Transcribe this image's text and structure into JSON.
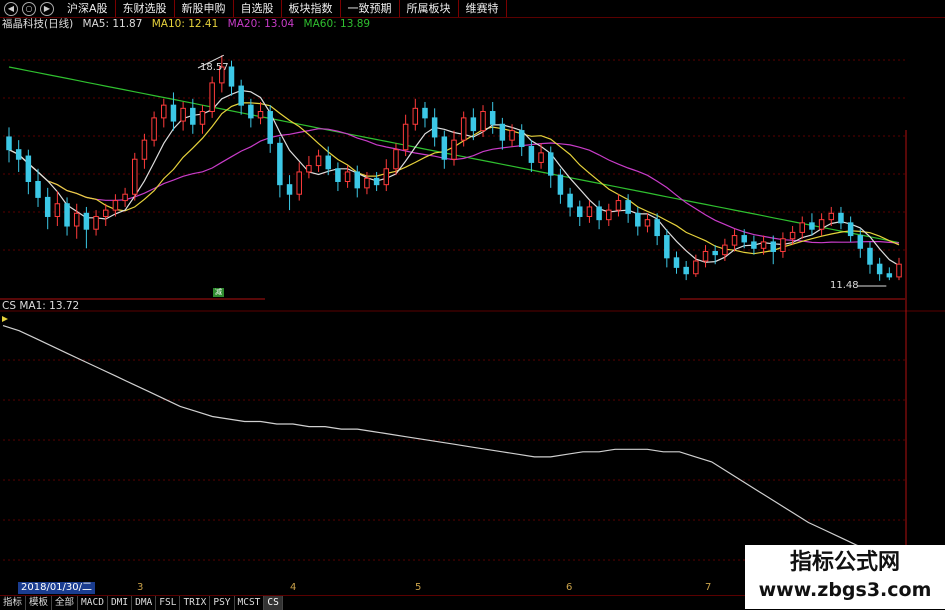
{
  "toolbar": {
    "icons": [
      "back-icon",
      "refresh-icon",
      "forward-icon"
    ],
    "tabs": [
      "沪深A股",
      "东财选股",
      "新股申购",
      "自选股",
      "板块指数",
      "一致预期",
      "所属板块",
      "维赛特"
    ]
  },
  "header": {
    "stock": "福晶科技(日线)",
    "ma5": "MA5: 11.87",
    "ma10": "MA10: 12.41",
    "ma20": "MA20: 13.04",
    "ma60": "MA60: 13.89"
  },
  "colors": {
    "up": "#ff3b3b",
    "down": "#3cc8e6",
    "ma5": "#dddddd",
    "ma10": "#e6d23c",
    "ma20": "#c83cc8",
    "ma60": "#2fbf2f",
    "grid": "#5a0000",
    "sub": "#d0d0d0"
  },
  "main_chart": {
    "high_label": "18.57",
    "low_label": "11.48",
    "marker_label": "减"
  },
  "sub_chart": {
    "label": "CS MA1: 13.72"
  },
  "chart_data": {
    "type": "candlestick",
    "title": "福晶科技(日线)",
    "candles": [
      {
        "o": 16.0,
        "c": 15.6,
        "h": 16.3,
        "l": 15.2
      },
      {
        "o": 15.6,
        "c": 15.3,
        "h": 15.9,
        "l": 14.9
      },
      {
        "o": 15.4,
        "c": 14.6,
        "h": 15.6,
        "l": 14.2
      },
      {
        "o": 14.6,
        "c": 14.1,
        "h": 15.0,
        "l": 13.8
      },
      {
        "o": 14.1,
        "c": 13.5,
        "h": 14.4,
        "l": 13.1
      },
      {
        "o": 13.5,
        "c": 13.9,
        "h": 14.3,
        "l": 13.2
      },
      {
        "o": 13.9,
        "c": 13.2,
        "h": 14.1,
        "l": 12.9
      },
      {
        "o": 13.2,
        "c": 13.6,
        "h": 13.9,
        "l": 12.8
      },
      {
        "o": 13.6,
        "c": 13.1,
        "h": 13.8,
        "l": 12.5
      },
      {
        "o": 13.1,
        "c": 13.5,
        "h": 13.7,
        "l": 12.9
      },
      {
        "o": 13.5,
        "c": 13.7,
        "h": 13.9,
        "l": 13.2
      },
      {
        "o": 13.7,
        "c": 14.0,
        "h": 14.2,
        "l": 13.5
      },
      {
        "o": 14.0,
        "c": 14.2,
        "h": 14.4,
        "l": 13.8
      },
      {
        "o": 14.2,
        "c": 15.3,
        "h": 15.5,
        "l": 14.0
      },
      {
        "o": 15.3,
        "c": 15.9,
        "h": 16.1,
        "l": 15.0
      },
      {
        "o": 15.9,
        "c": 16.6,
        "h": 16.8,
        "l": 15.7
      },
      {
        "o": 16.6,
        "c": 17.0,
        "h": 17.2,
        "l": 16.3
      },
      {
        "o": 17.0,
        "c": 16.5,
        "h": 17.4,
        "l": 16.2
      },
      {
        "o": 16.5,
        "c": 16.9,
        "h": 17.1,
        "l": 16.2
      },
      {
        "o": 16.9,
        "c": 16.4,
        "h": 17.2,
        "l": 16.1
      },
      {
        "o": 16.4,
        "c": 16.8,
        "h": 17.0,
        "l": 16.1
      },
      {
        "o": 16.8,
        "c": 17.7,
        "h": 17.9,
        "l": 16.6
      },
      {
        "o": 17.7,
        "c": 18.2,
        "h": 18.57,
        "l": 17.4
      },
      {
        "o": 18.2,
        "c": 17.6,
        "h": 18.4,
        "l": 17.3
      },
      {
        "o": 17.6,
        "c": 17.0,
        "h": 17.8,
        "l": 16.7
      },
      {
        "o": 17.0,
        "c": 16.6,
        "h": 17.2,
        "l": 16.3
      },
      {
        "o": 16.6,
        "c": 16.8,
        "h": 17.1,
        "l": 16.4
      },
      {
        "o": 16.8,
        "c": 15.8,
        "h": 17.0,
        "l": 15.5
      },
      {
        "o": 15.8,
        "c": 14.5,
        "h": 16.0,
        "l": 14.1
      },
      {
        "o": 14.5,
        "c": 14.2,
        "h": 14.8,
        "l": 13.7
      },
      {
        "o": 14.2,
        "c": 14.9,
        "h": 15.2,
        "l": 14.0
      },
      {
        "o": 14.9,
        "c": 15.1,
        "h": 15.4,
        "l": 14.7
      },
      {
        "o": 15.1,
        "c": 15.4,
        "h": 15.6,
        "l": 14.9
      },
      {
        "o": 15.4,
        "c": 15.0,
        "h": 15.7,
        "l": 14.8
      },
      {
        "o": 15.0,
        "c": 14.6,
        "h": 15.2,
        "l": 14.3
      },
      {
        "o": 14.6,
        "c": 14.9,
        "h": 15.1,
        "l": 14.4
      },
      {
        "o": 14.9,
        "c": 14.4,
        "h": 15.1,
        "l": 14.1
      },
      {
        "o": 14.4,
        "c": 14.7,
        "h": 14.9,
        "l": 14.2
      },
      {
        "o": 14.7,
        "c": 14.5,
        "h": 14.9,
        "l": 14.3
      },
      {
        "o": 14.5,
        "c": 15.0,
        "h": 15.3,
        "l": 14.3
      },
      {
        "o": 15.0,
        "c": 15.6,
        "h": 15.8,
        "l": 14.8
      },
      {
        "o": 15.6,
        "c": 16.4,
        "h": 16.7,
        "l": 15.4
      },
      {
        "o": 16.4,
        "c": 16.9,
        "h": 17.2,
        "l": 16.2
      },
      {
        "o": 16.9,
        "c": 16.6,
        "h": 17.1,
        "l": 16.3
      },
      {
        "o": 16.6,
        "c": 16.0,
        "h": 16.9,
        "l": 15.7
      },
      {
        "o": 16.0,
        "c": 15.3,
        "h": 16.2,
        "l": 15.0
      },
      {
        "o": 15.3,
        "c": 15.9,
        "h": 16.2,
        "l": 15.1
      },
      {
        "o": 15.9,
        "c": 16.6,
        "h": 16.8,
        "l": 15.7
      },
      {
        "o": 16.6,
        "c": 16.2,
        "h": 16.9,
        "l": 15.9
      },
      {
        "o": 16.2,
        "c": 16.8,
        "h": 17.0,
        "l": 16.0
      },
      {
        "o": 16.8,
        "c": 16.4,
        "h": 17.1,
        "l": 16.1
      },
      {
        "o": 16.4,
        "c": 15.9,
        "h": 16.6,
        "l": 15.6
      },
      {
        "o": 15.9,
        "c": 16.2,
        "h": 16.4,
        "l": 15.7
      },
      {
        "o": 16.2,
        "c": 15.7,
        "h": 16.4,
        "l": 15.4
      },
      {
        "o": 15.7,
        "c": 15.2,
        "h": 15.9,
        "l": 14.9
      },
      {
        "o": 15.2,
        "c": 15.5,
        "h": 15.8,
        "l": 15.0
      },
      {
        "o": 15.5,
        "c": 14.8,
        "h": 15.7,
        "l": 14.4
      },
      {
        "o": 14.8,
        "c": 14.2,
        "h": 15.0,
        "l": 13.9
      },
      {
        "o": 14.2,
        "c": 13.8,
        "h": 14.4,
        "l": 13.5
      },
      {
        "o": 13.8,
        "c": 13.5,
        "h": 14.0,
        "l": 13.2
      },
      {
        "o": 13.5,
        "c": 13.8,
        "h": 14.0,
        "l": 13.3
      },
      {
        "o": 13.8,
        "c": 13.4,
        "h": 14.0,
        "l": 13.1
      },
      {
        "o": 13.4,
        "c": 13.7,
        "h": 13.9,
        "l": 13.2
      },
      {
        "o": 13.7,
        "c": 14.0,
        "h": 14.2,
        "l": 13.5
      },
      {
        "o": 14.0,
        "c": 13.6,
        "h": 14.2,
        "l": 13.3
      },
      {
        "o": 13.6,
        "c": 13.2,
        "h": 13.8,
        "l": 12.9
      },
      {
        "o": 13.2,
        "c": 13.4,
        "h": 13.6,
        "l": 13.0
      },
      {
        "o": 13.4,
        "c": 12.9,
        "h": 13.6,
        "l": 12.6
      },
      {
        "o": 12.9,
        "c": 12.2,
        "h": 13.1,
        "l": 11.9
      },
      {
        "o": 12.2,
        "c": 11.9,
        "h": 12.4,
        "l": 11.7
      },
      {
        "o": 11.9,
        "c": 11.7,
        "h": 12.1,
        "l": 11.5
      },
      {
        "o": 11.7,
        "c": 12.1,
        "h": 12.3,
        "l": 11.6
      },
      {
        "o": 12.1,
        "c": 12.4,
        "h": 12.6,
        "l": 11.9
      },
      {
        "o": 12.4,
        "c": 12.3,
        "h": 12.6,
        "l": 12.0
      },
      {
        "o": 12.3,
        "c": 12.6,
        "h": 12.8,
        "l": 12.1
      },
      {
        "o": 12.6,
        "c": 12.9,
        "h": 13.1,
        "l": 12.4
      },
      {
        "o": 12.9,
        "c": 12.7,
        "h": 13.1,
        "l": 12.5
      },
      {
        "o": 12.7,
        "c": 12.5,
        "h": 12.9,
        "l": 12.3
      },
      {
        "o": 12.5,
        "c": 12.7,
        "h": 12.9,
        "l": 12.3
      },
      {
        "o": 12.7,
        "c": 12.4,
        "h": 12.9,
        "l": 12.0
      },
      {
        "o": 12.4,
        "c": 12.8,
        "h": 13.0,
        "l": 12.2
      },
      {
        "o": 12.8,
        "c": 13.0,
        "h": 13.2,
        "l": 12.6
      },
      {
        "o": 13.0,
        "c": 13.3,
        "h": 13.5,
        "l": 12.8
      },
      {
        "o": 13.3,
        "c": 13.1,
        "h": 13.6,
        "l": 12.9
      },
      {
        "o": 13.1,
        "c": 13.4,
        "h": 13.6,
        "l": 12.9
      },
      {
        "o": 13.4,
        "c": 13.6,
        "h": 13.8,
        "l": 13.2
      },
      {
        "o": 13.6,
        "c": 13.3,
        "h": 13.8,
        "l": 13.1
      },
      {
        "o": 13.3,
        "c": 12.9,
        "h": 13.5,
        "l": 12.7
      },
      {
        "o": 12.9,
        "c": 12.5,
        "h": 13.1,
        "l": 12.2
      },
      {
        "o": 12.5,
        "c": 12.0,
        "h": 12.7,
        "l": 11.7
      },
      {
        "o": 12.0,
        "c": 11.7,
        "h": 12.2,
        "l": 11.48
      },
      {
        "o": 11.7,
        "c": 11.6,
        "h": 11.9,
        "l": 11.5
      },
      {
        "o": 11.6,
        "c": 12.0,
        "h": 12.2,
        "l": 11.5
      }
    ],
    "ylim": [
      11.0,
      19.3
    ],
    "cs_series": [
      20.0,
      19.8,
      19.5,
      19.2,
      18.9,
      18.6,
      18.3,
      18.0,
      17.7,
      17.4,
      17.1,
      16.8,
      16.6,
      16.4,
      16.3,
      16.2,
      16.2,
      16.1,
      16.1,
      16.0,
      16.0,
      15.9,
      15.9,
      15.8,
      15.7,
      15.6,
      15.5,
      15.4,
      15.3,
      15.2,
      15.1,
      15.0,
      14.9,
      14.8,
      14.8,
      14.9,
      15.0,
      15.0,
      15.1,
      15.1,
      15.1,
      15.0,
      15.0,
      14.8,
      14.6,
      14.2,
      13.8,
      13.4,
      13.0,
      12.6,
      12.2,
      11.9,
      11.6,
      11.3,
      11.1,
      10.9,
      10.7
    ],
    "cs_ylim": [
      10.0,
      20.5
    ],
    "x_ticks": [
      "3",
      "4",
      "5",
      "6",
      "7"
    ],
    "date_label": "2018/01/30/二"
  },
  "bottom_tabs": [
    "指标",
    "模板",
    "全部",
    "MACD",
    "DMI",
    "DMA",
    "FSL",
    "TRIX",
    "PSY",
    "MCST",
    "CS"
  ],
  "watermark": {
    "title": "指标公式网",
    "url": "www.zbgs3.com"
  }
}
